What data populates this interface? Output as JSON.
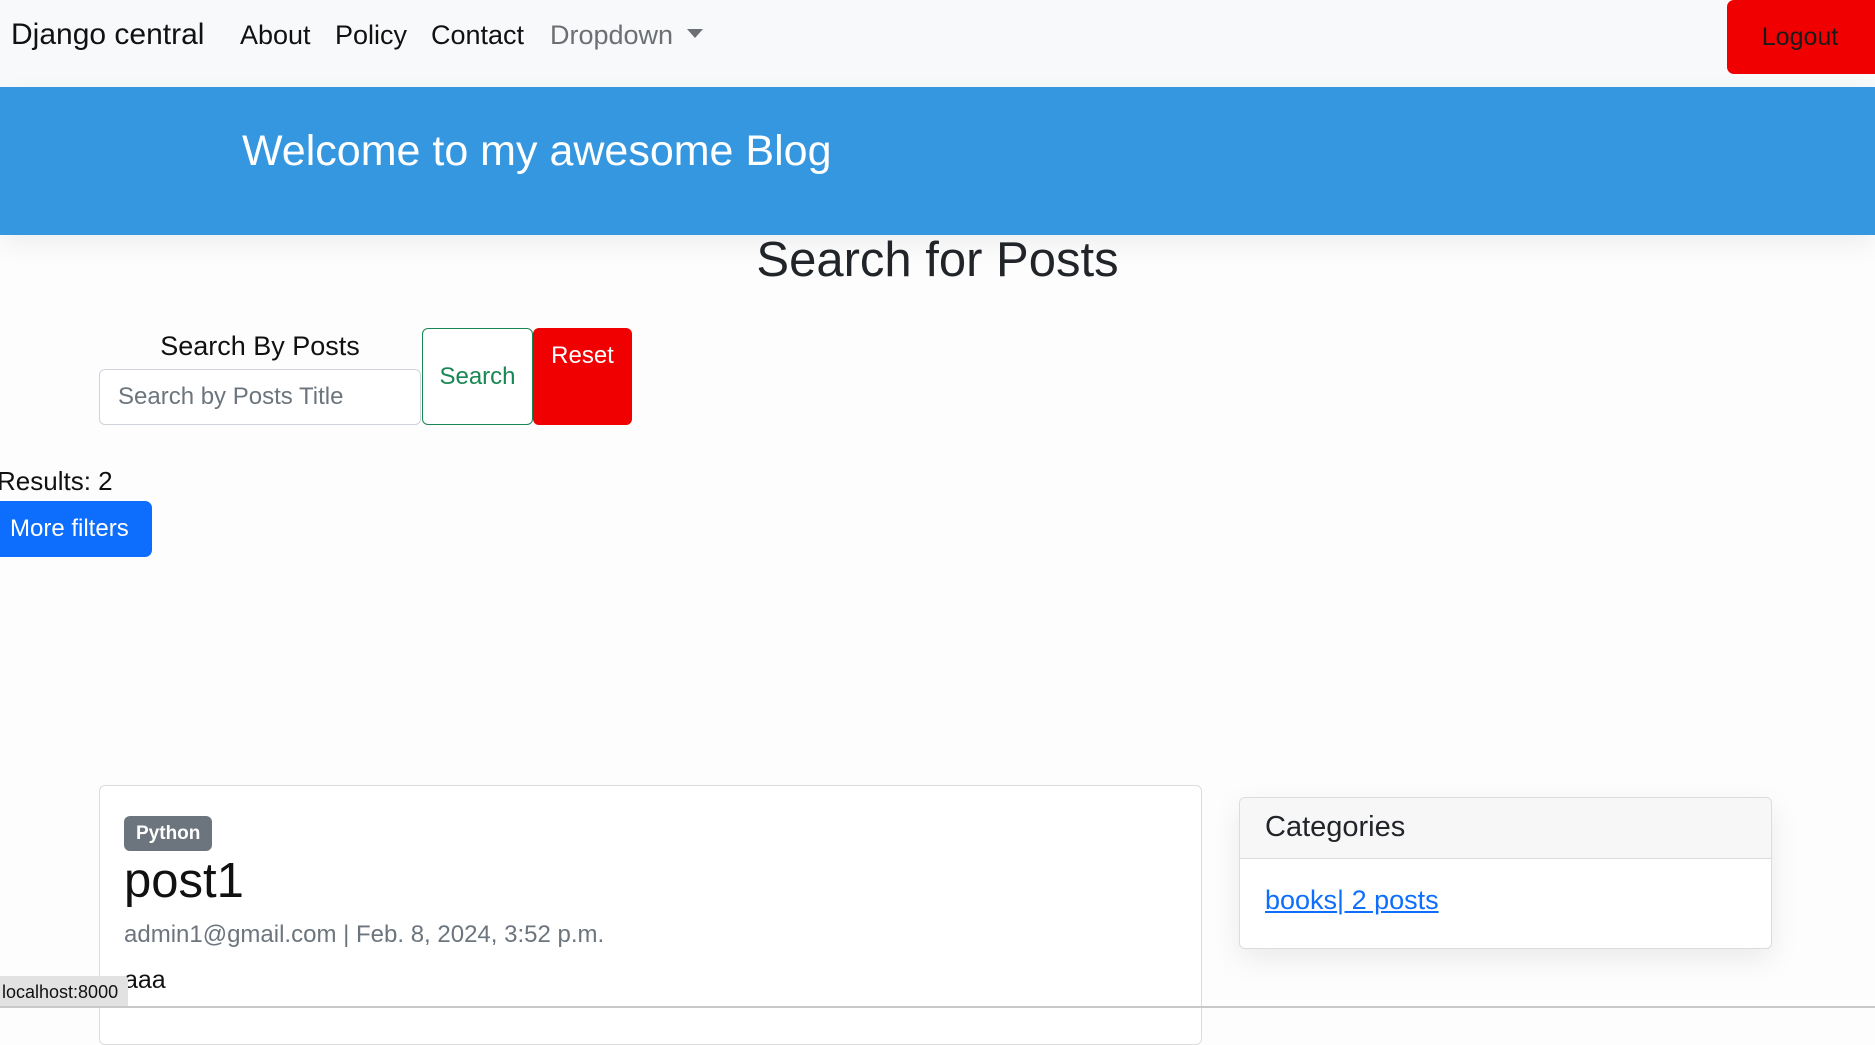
{
  "navbar": {
    "brand": "Django central",
    "links": {
      "about": "About",
      "policy": "Policy",
      "contact": "Contact",
      "dropdown": "Dropdown"
    },
    "logout_label": "Logout"
  },
  "hero": {
    "title": "Welcome to my awesome Blog"
  },
  "search": {
    "heading": "Search for Posts",
    "label": "Search By Posts",
    "placeholder": "Search by Posts Title",
    "value": "",
    "search_label": "Search",
    "reset_label": "Reset"
  },
  "results": {
    "text": "Results: 2",
    "more_filters_label": "More filters"
  },
  "post": {
    "badge": "Python",
    "title": "post1",
    "meta": "admin1@gmail.com | Feb. 8, 2024, 3:52 p.m.",
    "body": "aaa"
  },
  "categories": {
    "title": "Categories",
    "items": [
      {
        "label": "books| 2 posts"
      }
    ]
  },
  "status_bar": {
    "url": "localhost:8000"
  },
  "colors": {
    "navbar_bg": "#f8f9fa",
    "hero_bg": "#3597e0",
    "danger": "#f00000",
    "primary": "#0d6efd",
    "success": "#198754",
    "secondary": "#6c757d"
  }
}
